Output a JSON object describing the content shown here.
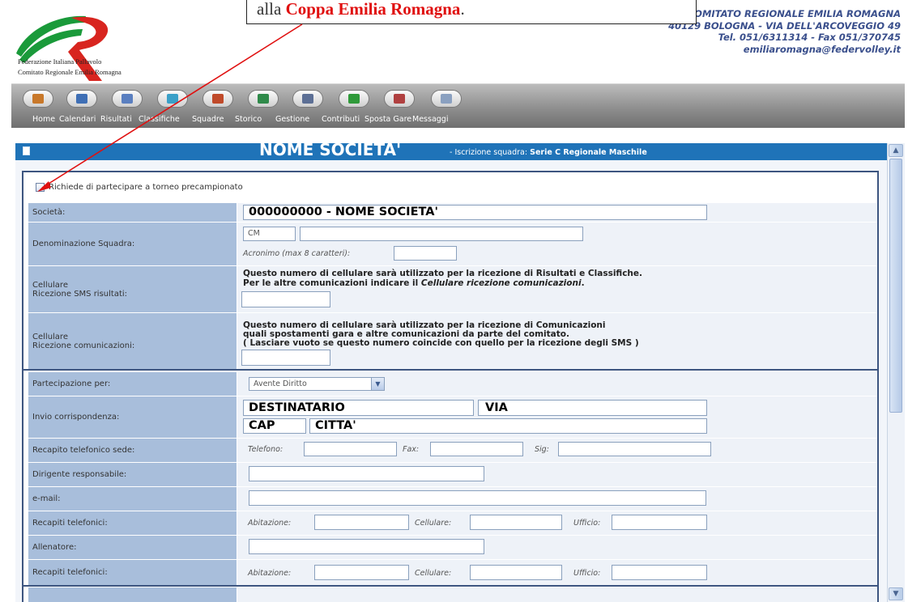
{
  "callout": {
    "prefix": "alla",
    "highlight": "Coppa Emilia Romagna",
    "suffix": "."
  },
  "logo": {
    "line1": "Federazione Italiana Pallavolo",
    "line2": "Comitato Regionale Emilia Romagna"
  },
  "contact": {
    "line1": "COMITATO REGIONALE EMILIA ROMAGNA",
    "line2": "40129 BOLOGNA - VIA DELL'ARCOVEGGIO 49",
    "line3": "Tel. 051/6311314 - Fax 051/370745",
    "line4": "emiliaromagna@federvolley.it"
  },
  "nav": [
    {
      "label": "Home",
      "icon": "home-icon",
      "color": "#c8782a"
    },
    {
      "label": "Calendari",
      "icon": "calendar-icon",
      "color": "#3f6fb5"
    },
    {
      "label": "Risultati",
      "icon": "ball-icon",
      "color": "#5a7fc0"
    },
    {
      "label": "Classifiche",
      "icon": "chart-icon",
      "color": "#3aa0c8"
    },
    {
      "label": "Squadre",
      "icon": "team-icon",
      "color": "#c04a2a"
    },
    {
      "label": "Storico",
      "icon": "history-icon",
      "color": "#2f8a4a"
    },
    {
      "label": "Gestione",
      "icon": "gear-icon",
      "color": "#5c6f95"
    },
    {
      "label": "Contributi",
      "icon": "euro-icon",
      "color": "#2f9a3a"
    },
    {
      "label": "Sposta Gare",
      "icon": "move-icon",
      "color": "#b04040"
    },
    {
      "label": "Messaggi",
      "icon": "mail-icon",
      "color": "#8aa0c0"
    }
  ],
  "panel": {
    "title": "NOME SOCIETA'",
    "subtitle_prefix": "- Iscrizione squadra:",
    "subtitle_value": "Serie C Regionale Maschile"
  },
  "form": {
    "torneo_label": "Richiede di partecipare a torneo precampionato",
    "societa": {
      "label": "Società:",
      "value": "000000000 - NOME SOCIETA'"
    },
    "denominazione": {
      "label": "Denominazione Squadra:",
      "prefix": "CM",
      "acronimo_label": "Acronimo (max 8 caratteri):"
    },
    "sms": {
      "label1": "Cellulare",
      "label2": "Ricezione SMS risultati:",
      "note1": "Questo numero di cellulare sarà utilizzato per la ricezione di Risultati e Classifiche.",
      "note2_prefix": "Per le altre comunicazioni indicare il ",
      "note2_italic": "Cellulare ricezione comunicazioni",
      "note2_suffix": "."
    },
    "comunicazioni": {
      "label1": "Cellulare",
      "label2": "Ricezione comunicazioni:",
      "note1": "Questo numero di cellulare sarà utilizzato per la ricezione di Comunicazioni",
      "note2": "quali spostamenti gara e altre comunicazioni da parte del comitato.",
      "note3": "( Lasciare vuoto se questo numero coincide con quello per la ricezione degli SMS )"
    },
    "partecipazione": {
      "label": "Partecipazione per:",
      "value": "Avente Diritto"
    },
    "corrispondenza": {
      "label": "Invio corrispondenza:",
      "destinatario": "DESTINATARIO",
      "via": "VIA",
      "cap": "CAP",
      "citta": "CITTA'"
    },
    "recapito_sede": {
      "label": "Recapito telefonico sede:",
      "telefono": "Telefono:",
      "fax": "Fax:",
      "sig": "Sig:"
    },
    "dirigente": {
      "label": "Dirigente responsabile:"
    },
    "email": {
      "label": "e-mail:"
    },
    "recapiti1": {
      "label": "Recapiti telefonici:",
      "abitazione": "Abitazione:",
      "cellulare": "Cellulare:",
      "ufficio": "Ufficio:"
    },
    "allenatore": {
      "label": "Allenatore:"
    },
    "recapiti2": {
      "label": "Recapiti telefonici:",
      "abitazione": "Abitazione:",
      "cellulare": "Cellulare:",
      "ufficio": "Ufficio:"
    }
  }
}
